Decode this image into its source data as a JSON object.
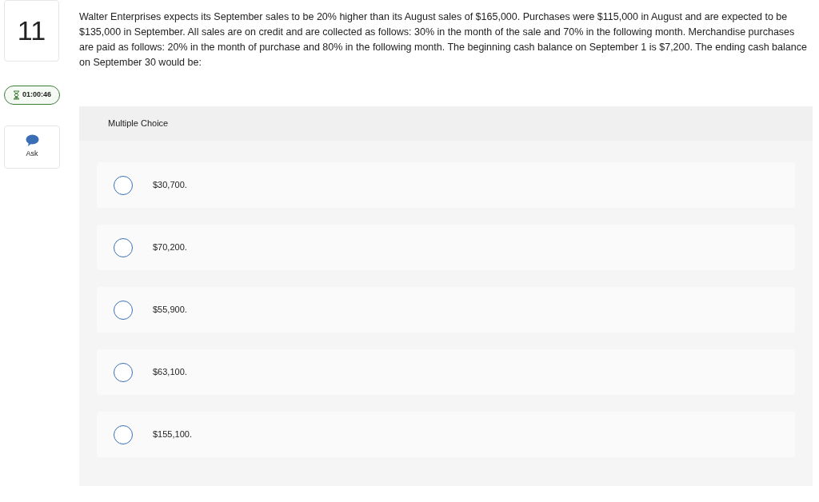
{
  "question_number": "11",
  "timer": "01:00:46",
  "ask_button": "Ask",
  "question": "Walter Enterprises expects its September sales to be 20% higher than its August sales of $165,000. Purchases were $115,000 in August and are expected to be $135,000 in September. All sales are on credit and are collected as follows: 30% in the month of the sale and 70% in the following month. Merchandise purchases are paid as follows: 20% in the month of purchase and 80% in the following month. The beginning cash balance on September 1 is $7,200. The ending cash balance on September 30 would be:",
  "answer_panel": {
    "heading": "Multiple Choice",
    "options": [
      {
        "label": "$30,700.",
        "selected": false
      },
      {
        "label": "$70,200.",
        "selected": false
      },
      {
        "label": "$55,900.",
        "selected": false
      },
      {
        "label": "$63,100.",
        "selected": false
      },
      {
        "label": "$155,100.",
        "selected": false
      }
    ]
  }
}
